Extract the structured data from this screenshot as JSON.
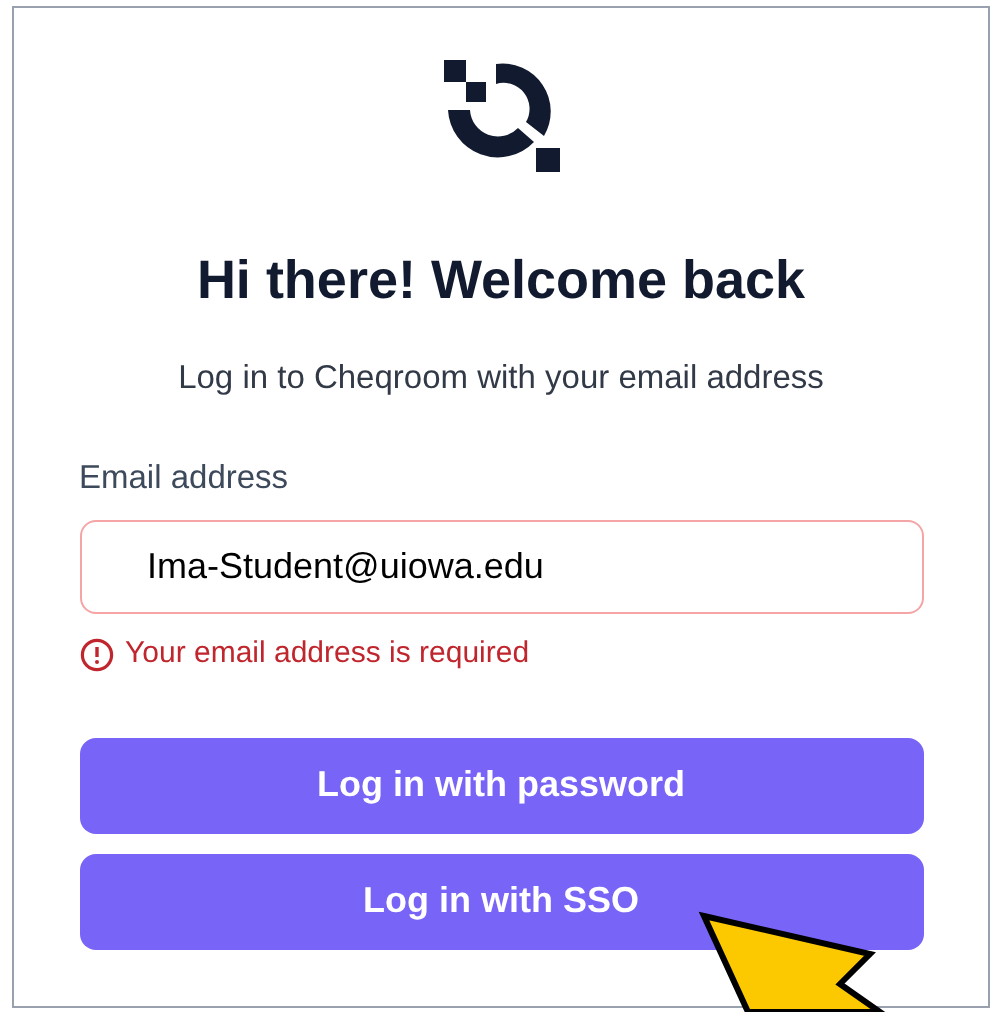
{
  "heading": "Hi there! Welcome back",
  "subtitle": "Log in to Cheqroom with your email address",
  "email_field": {
    "label": "Email address",
    "value": "Ima-Student@uiowa.edu",
    "invalid": true,
    "error": "Your email address is required"
  },
  "buttons": [
    {
      "label": "Log in with password"
    },
    {
      "label": "Log in with SSO"
    }
  ]
}
